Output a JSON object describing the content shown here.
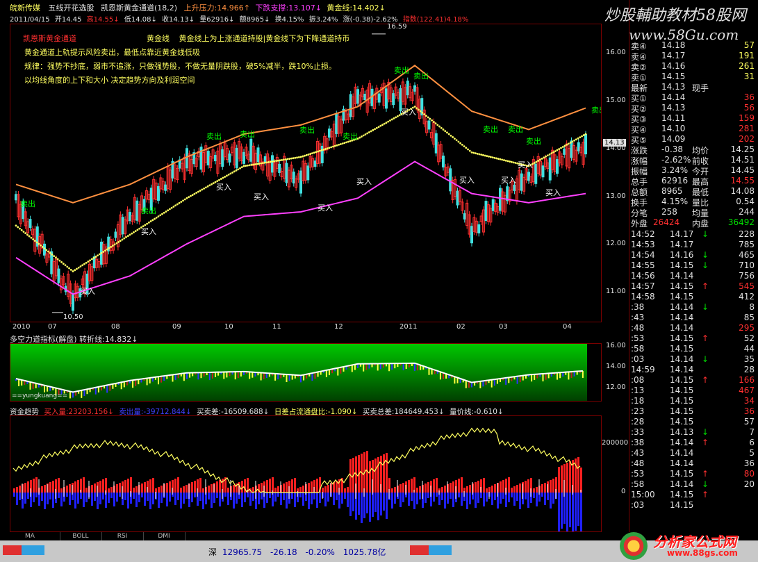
{
  "header": {
    "app_name": "皖新传媒",
    "indicator": "五线开花选股",
    "indicator2": "凯恩斯黄金通道(18,2)",
    "resist_label": "上升压力:14.966↑",
    "support_label": "下跌支撑:13.107↓",
    "gold_label": "黄金线:14.402↓",
    "date": "2011/04/15",
    "open": "开14.45",
    "high": "高14.55↓",
    "low": "低14.08↓",
    "close": "收14.13↓",
    "vol": "量62916↓",
    "amount": "额8965↓",
    "turnover": "换4.15%",
    "amp": "振3.24%",
    "chg": "涨(-0.38)-2.62%",
    "index": "指数(122.41)4.18%"
  },
  "annotations": {
    "title_red": "凯恩斯黄金通道",
    "line1a": "黄金线",
    "line1b": "黄金线上为上涨通道持股|黄金线下为下降通道持币",
    "line2": "黄金通道上轨提示风险卖出，最低点靠近黄金线低吸",
    "line3": "规律：强势不抄底，弱市不追涨，只做强势股，不做无量阴跌股，破5%减半，跌10%止损。",
    "line4": "以均线角度的上下和大小 决定趋势方向及利润空间",
    "high_mark": "16.59",
    "low_mark": "10.50",
    "sell": "卖出",
    "buy": "买入"
  },
  "x_axis": {
    "labels": [
      "2010",
      "07",
      "08",
      "09",
      "10",
      "11",
      "12",
      "2011",
      "02",
      "03",
      "04"
    ],
    "period": "日线"
  },
  "y_axis_main": [
    "16.00",
    "15.00",
    "14.00",
    "13.00",
    "12.00",
    "11.00"
  ],
  "price_tag": "14.13",
  "sub1": {
    "title": "多空力道指标(解盘) 转折线:14.832↓",
    "y_labels": [
      "16.00",
      "14.00",
      "12.00"
    ],
    "footer": "==yungkuang=="
  },
  "sub2": {
    "title_a": "资金趋势",
    "title_b": "买入量:23203.156↓",
    "title_c": "卖出量:-39712.844↓",
    "title_d": "买卖差:-16509.688↓",
    "title_e": "日差占流通盘比:-1.090↓",
    "title_f": "买卖总差:184649.453↓",
    "title_g": "量价线:-0.610↓",
    "y_labels": [
      "200000",
      "0"
    ]
  },
  "tabs": [
    "MA",
    "BOLL",
    "RSI",
    "DMI"
  ],
  "status": {
    "market": "深",
    "value": "12965.75",
    "change": "-26.18",
    "pct": "-0.20%",
    "amount": "1025.78亿"
  },
  "watermarks": {
    "top": "炒股輔助教材58股网",
    "url": "www.58Gu.com",
    "bottom": "分析家公式网",
    "bottom_url": "www.88gs.com"
  },
  "quote": {
    "asks": [
      {
        "label": "卖④",
        "price": "14.18",
        "vol": "57"
      },
      {
        "label": "卖④",
        "price": "14.17",
        "vol": "191"
      },
      {
        "label": "卖②",
        "price": "14.16",
        "vol": "261"
      },
      {
        "label": "卖①",
        "price": "14.15",
        "vol": "31"
      }
    ],
    "latest_label": "最新",
    "latest_price": "14.13",
    "latest_note": "现手",
    "bids": [
      {
        "label": "买①",
        "price": "14.14",
        "vol": "36"
      },
      {
        "label": "买②",
        "price": "14.13",
        "vol": "56"
      },
      {
        "label": "买③",
        "price": "14.11",
        "vol": "159"
      },
      {
        "label": "买④",
        "price": "14.10",
        "vol": "281"
      },
      {
        "label": "买⑤",
        "price": "14.09",
        "vol": "202"
      }
    ],
    "stats": [
      {
        "l1": "涨跌",
        "v1": "-0.38",
        "l2": "均价",
        "v2": "14.25"
      },
      {
        "l1": "涨幅",
        "v1": "-2.62%",
        "l2": "前收",
        "v2": "14.51"
      },
      {
        "l1": "振幅",
        "v1": "3.24%",
        "l2": "今开",
        "v2": "14.45"
      },
      {
        "l1": "总手",
        "v1": "62916",
        "l2": "最高",
        "v2": "14.55"
      },
      {
        "l1": "总额",
        "v1": "8965",
        "l2": "最低",
        "v2": "14.08"
      },
      {
        "l1": "换手",
        "v1": "4.15%",
        "l2": "量比",
        "v2": "0.54"
      },
      {
        "l1": "分笔",
        "v1": "258",
        "l2": "均量",
        "v2": "244"
      }
    ],
    "outer_label": "外盘",
    "outer_value": "26424",
    "inner_label": "内盘",
    "inner_value": "36492",
    "ticks": [
      {
        "t": "14:52",
        "p": "14.17",
        "a": "↓",
        "v": "228",
        "c": "wh"
      },
      {
        "t": "14:53",
        "p": "14.17",
        "a": "",
        "v": "785",
        "c": "wh"
      },
      {
        "t": "14:54",
        "p": "14.16",
        "a": "↓",
        "v": "465",
        "c": "wh"
      },
      {
        "t": "14:55",
        "p": "14.15",
        "a": "↓",
        "v": "710",
        "c": "wh"
      },
      {
        "t": "14:56",
        "p": "14.14",
        "a": "",
        "v": "756",
        "c": "wh"
      },
      {
        "t": "14:57",
        "p": "14.15",
        "a": "↑",
        "v": "545",
        "c": "red"
      },
      {
        "t": "14:58",
        "p": "14.15",
        "a": "",
        "v": "412",
        "c": "wh"
      },
      {
        "t": ":38",
        "p": "14.14",
        "a": "↓",
        "v": "8",
        "c": "wh"
      },
      {
        "t": ":43",
        "p": "14.14",
        "a": "",
        "v": "85",
        "c": "wh"
      },
      {
        "t": ":48",
        "p": "14.14",
        "a": "",
        "v": "295",
        "c": "red"
      },
      {
        "t": ":53",
        "p": "14.15",
        "a": "↑",
        "v": "52",
        "c": "wh"
      },
      {
        "t": ":58",
        "p": "14.15",
        "a": "",
        "v": "44",
        "c": "wh"
      },
      {
        "t": ":03",
        "p": "14.14",
        "a": "↓",
        "v": "35",
        "c": "wh"
      },
      {
        "t": "14:59",
        "p": "14.14",
        "a": "",
        "v": "28",
        "c": "wh"
      },
      {
        "t": ":08",
        "p": "14.15",
        "a": "↑",
        "v": "166",
        "c": "red"
      },
      {
        "t": ":13",
        "p": "14.15",
        "a": "",
        "v": "467",
        "c": "red"
      },
      {
        "t": ":18",
        "p": "14.15",
        "a": "",
        "v": "34",
        "c": "red"
      },
      {
        "t": ":23",
        "p": "14.15",
        "a": "",
        "v": "36",
        "c": "red"
      },
      {
        "t": ":28",
        "p": "14.15",
        "a": "",
        "v": "57",
        "c": "wh"
      },
      {
        "t": ":33",
        "p": "14.13",
        "a": "↓",
        "v": "7",
        "c": "wh"
      },
      {
        "t": ":38",
        "p": "14.14",
        "a": "↑",
        "v": "6",
        "c": "wh"
      },
      {
        "t": ":43",
        "p": "14.14",
        "a": "",
        "v": "5",
        "c": "wh"
      },
      {
        "t": ":48",
        "p": "14.14",
        "a": "",
        "v": "36",
        "c": "wh"
      },
      {
        "t": ":53",
        "p": "14.15",
        "a": "↑",
        "v": "80",
        "c": "red"
      },
      {
        "t": ":58",
        "p": "14.14",
        "a": "↓",
        "v": "20",
        "c": "wh"
      },
      {
        "t": "15:00",
        "p": "14.15",
        "a": "↑",
        "v": "",
        "c": "wh"
      },
      {
        "t": ":03",
        "p": "14.15",
        "a": "",
        "v": "",
        "c": "wh"
      }
    ]
  },
  "chart_data": {
    "type": "line",
    "title": "凯恩斯黄金通道(18,2)",
    "x": [
      "2010-06",
      "2010-07",
      "2010-08",
      "2010-09",
      "2010-10",
      "2010-11",
      "2010-12",
      "2011-01",
      "2011-02",
      "2011-03",
      "2011-04"
    ],
    "ylim": [
      10.3,
      16.8
    ],
    "series": [
      {
        "name": "上升压力",
        "color": "#ff9040",
        "values": [
          13.3,
          12.9,
          13.3,
          13.9,
          14.4,
          14.6,
          15.0,
          15.9,
          14.9,
          14.5,
          14.97
        ]
      },
      {
        "name": "下跌支撑",
        "color": "#ff40ff",
        "values": [
          11.7,
          10.9,
          11.3,
          12.0,
          12.6,
          12.7,
          13.0,
          13.8,
          13.1,
          12.9,
          13.1
        ]
      },
      {
        "name": "黄金线",
        "color": "#ffff60",
        "values": [
          12.4,
          11.4,
          12.2,
          13.0,
          13.7,
          13.9,
          14.3,
          15.0,
          14.0,
          13.7,
          14.4
        ]
      },
      {
        "name": "收",
        "color": "#ff3030",
        "values": [
          12.9,
          10.8,
          12.6,
          13.8,
          14.0,
          13.4,
          15.2,
          15.3,
          12.3,
          13.5,
          14.13
        ]
      }
    ],
    "annotations": {
      "max": 16.59,
      "min": 10.5
    }
  }
}
